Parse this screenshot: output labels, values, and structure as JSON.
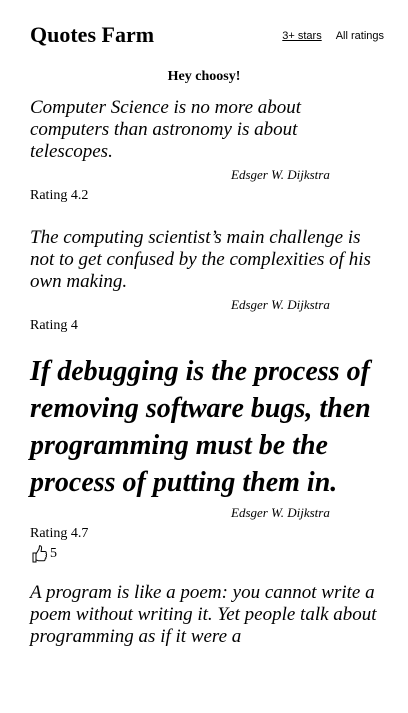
{
  "header": {
    "brand": "Quotes Farm",
    "nav": [
      {
        "label": "3+ stars"
      },
      {
        "label": "All ratings"
      }
    ]
  },
  "banner": "Hey choosy!",
  "quotes": [
    {
      "text": "Computer Science is no more about computers than astronomy is about telescopes.",
      "author": "Edsger W. Dijkstra",
      "rating": "Rating 4.2"
    },
    {
      "text": "The computing scientist’s main challenge is not to get confused by the complexities of his own making.",
      "author": "Edsger W. Dijkstra",
      "rating": "Rating 4"
    },
    {
      "text": "If debugging is the process of removing software bugs, then programming must be the process of putting them in.",
      "author": "Edsger W. Dijkstra",
      "rating": "Rating 4.7",
      "likes": "5",
      "likes_icon": "thumbs-up-icon"
    },
    {
      "text": "A program is like a poem: you cannot write a poem without writing it. Yet people talk about programming as if it were a"
    }
  ]
}
